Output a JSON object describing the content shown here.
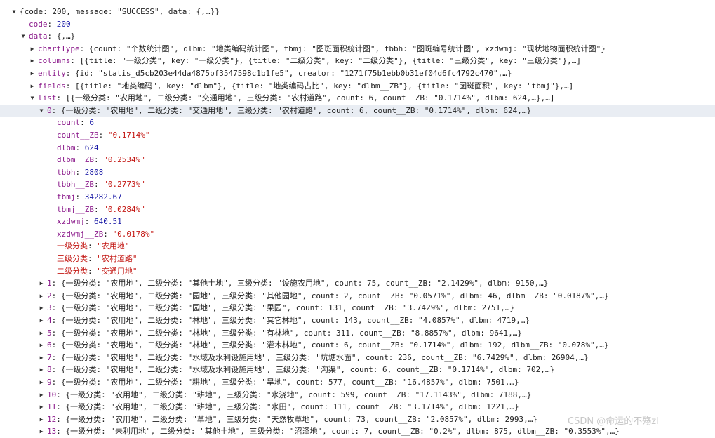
{
  "watermark": "CSDN @命运的不殇zl",
  "lines": [
    {
      "indent": 0,
      "toggle": "open",
      "selected": false,
      "parts": [
        {
          "t": "{code: 200, message: \"SUCCESS\", data: {,…}}",
          "c": "punc"
        }
      ]
    },
    {
      "indent": 1,
      "toggle": "none",
      "selected": false,
      "parts": [
        {
          "t": "code",
          "c": "key"
        },
        {
          "t": ": ",
          "c": "punc"
        },
        {
          "t": "200",
          "c": "num"
        }
      ]
    },
    {
      "indent": 1,
      "toggle": "open",
      "selected": false,
      "parts": [
        {
          "t": "data",
          "c": "key"
        },
        {
          "t": ": {,…}",
          "c": "punc"
        }
      ]
    },
    {
      "indent": 2,
      "toggle": "closed",
      "selected": false,
      "parts": [
        {
          "t": "chartType",
          "c": "key"
        },
        {
          "t": ": {count: \"个数统计图\", dlbm: \"地类编码统计图\", tbmj: \"图斑面积统计图\", tbbh: \"图斑编号统计图\", xzdwmj: \"现状地物面积统计图\"}",
          "c": "punc"
        }
      ]
    },
    {
      "indent": 2,
      "toggle": "closed",
      "selected": false,
      "parts": [
        {
          "t": "columns",
          "c": "key"
        },
        {
          "t": ": [{title: \"一级分类\", key: \"一级分类\"}, {title: \"二级分类\", key: \"二级分类\"}, {title: \"三级分类\", key: \"三级分类\"},…]",
          "c": "punc"
        }
      ]
    },
    {
      "indent": 2,
      "toggle": "closed",
      "selected": false,
      "parts": [
        {
          "t": "entity",
          "c": "key"
        },
        {
          "t": ": {id: \"statis_d5cb203e44da4875bf3547598c1b1fe5\", creator: \"1271f75b1ebb0b31ef04d6fc4792c470\",…}",
          "c": "punc"
        }
      ]
    },
    {
      "indent": 2,
      "toggle": "closed",
      "selected": false,
      "parts": [
        {
          "t": "fields",
          "c": "key"
        },
        {
          "t": ": [{title: \"地类编码\", key: \"dlbm\"}, {title: \"地类编码占比\", key: \"dlbm__ZB\"}, {title: \"图斑面积\", key: \"tbmj\"},…]",
          "c": "punc"
        }
      ]
    },
    {
      "indent": 2,
      "toggle": "open",
      "selected": false,
      "parts": [
        {
          "t": "list",
          "c": "key"
        },
        {
          "t": ": [{一级分类: \"农用地\", 二级分类: \"交通用地\", 三级分类: \"农村道路\", count: 6, count__ZB: \"0.1714%\", dlbm: 624,…},…]",
          "c": "punc"
        }
      ]
    },
    {
      "indent": 3,
      "toggle": "open",
      "selected": true,
      "parts": [
        {
          "t": "0",
          "c": "key"
        },
        {
          "t": ": {一级分类: \"农用地\", 二级分类: \"交通用地\", 三级分类: \"农村道路\", count: 6, count__ZB: \"0.1714%\", dlbm: 624,…}",
          "c": "punc"
        }
      ]
    },
    {
      "indent": 4,
      "toggle": "none",
      "selected": false,
      "parts": [
        {
          "t": "count",
          "c": "key"
        },
        {
          "t": ": ",
          "c": "punc"
        },
        {
          "t": "6",
          "c": "num"
        }
      ]
    },
    {
      "indent": 4,
      "toggle": "none",
      "selected": false,
      "parts": [
        {
          "t": "count__ZB",
          "c": "key"
        },
        {
          "t": ": ",
          "c": "punc"
        },
        {
          "t": "\"0.1714%\"",
          "c": "str"
        }
      ]
    },
    {
      "indent": 4,
      "toggle": "none",
      "selected": false,
      "parts": [
        {
          "t": "dlbm",
          "c": "key"
        },
        {
          "t": ": ",
          "c": "punc"
        },
        {
          "t": "624",
          "c": "num"
        }
      ]
    },
    {
      "indent": 4,
      "toggle": "none",
      "selected": false,
      "parts": [
        {
          "t": "dlbm__ZB",
          "c": "key"
        },
        {
          "t": ": ",
          "c": "punc"
        },
        {
          "t": "\"0.2534%\"",
          "c": "str"
        }
      ]
    },
    {
      "indent": 4,
      "toggle": "none",
      "selected": false,
      "parts": [
        {
          "t": "tbbh",
          "c": "key"
        },
        {
          "t": ": ",
          "c": "punc"
        },
        {
          "t": "2808",
          "c": "num"
        }
      ]
    },
    {
      "indent": 4,
      "toggle": "none",
      "selected": false,
      "parts": [
        {
          "t": "tbbh__ZB",
          "c": "key"
        },
        {
          "t": ": ",
          "c": "punc"
        },
        {
          "t": "\"0.2773%\"",
          "c": "str"
        }
      ]
    },
    {
      "indent": 4,
      "toggle": "none",
      "selected": false,
      "parts": [
        {
          "t": "tbmj",
          "c": "key"
        },
        {
          "t": ": ",
          "c": "punc"
        },
        {
          "t": "34282.67",
          "c": "num"
        }
      ]
    },
    {
      "indent": 4,
      "toggle": "none",
      "selected": false,
      "parts": [
        {
          "t": "tbmj__ZB",
          "c": "key"
        },
        {
          "t": ": ",
          "c": "punc"
        },
        {
          "t": "\"0.0284%\"",
          "c": "str"
        }
      ]
    },
    {
      "indent": 4,
      "toggle": "none",
      "selected": false,
      "parts": [
        {
          "t": "xzdwmj",
          "c": "key"
        },
        {
          "t": ": ",
          "c": "punc"
        },
        {
          "t": "640.51",
          "c": "num"
        }
      ]
    },
    {
      "indent": 4,
      "toggle": "none",
      "selected": false,
      "parts": [
        {
          "t": "xzdwmj__ZB",
          "c": "key"
        },
        {
          "t": ": ",
          "c": "punc"
        },
        {
          "t": "\"0.0178%\"",
          "c": "str"
        }
      ]
    },
    {
      "indent": 4,
      "toggle": "none",
      "selected": false,
      "parts": [
        {
          "t": "一级分类",
          "c": "key plain"
        },
        {
          "t": ": ",
          "c": "punc"
        },
        {
          "t": "\"农用地\"",
          "c": "str"
        }
      ]
    },
    {
      "indent": 4,
      "toggle": "none",
      "selected": false,
      "parts": [
        {
          "t": "三级分类",
          "c": "key plain"
        },
        {
          "t": ": ",
          "c": "punc"
        },
        {
          "t": "\"农村道路\"",
          "c": "str"
        }
      ]
    },
    {
      "indent": 4,
      "toggle": "none",
      "selected": false,
      "parts": [
        {
          "t": "二级分类",
          "c": "key plain"
        },
        {
          "t": ": ",
          "c": "punc"
        },
        {
          "t": "\"交通用地\"",
          "c": "str"
        }
      ]
    },
    {
      "indent": 3,
      "toggle": "closed",
      "selected": false,
      "parts": [
        {
          "t": "1",
          "c": "key"
        },
        {
          "t": ": {一级分类: \"农用地\", 二级分类: \"其他土地\", 三级分类: \"设施农用地\", count: 75, count__ZB: \"2.1429%\", dlbm: 9150,…}",
          "c": "punc"
        }
      ]
    },
    {
      "indent": 3,
      "toggle": "closed",
      "selected": false,
      "parts": [
        {
          "t": "2",
          "c": "key"
        },
        {
          "t": ": {一级分类: \"农用地\", 二级分类: \"园地\", 三级分类: \"其他园地\", count: 2, count__ZB: \"0.0571%\", dlbm: 46, dlbm__ZB: \"0.0187%\",…}",
          "c": "punc"
        }
      ]
    },
    {
      "indent": 3,
      "toggle": "closed",
      "selected": false,
      "parts": [
        {
          "t": "3",
          "c": "key"
        },
        {
          "t": ": {一级分类: \"农用地\", 二级分类: \"园地\", 三级分类: \"果园\", count: 131, count__ZB: \"3.7429%\", dlbm: 2751,…}",
          "c": "punc"
        }
      ]
    },
    {
      "indent": 3,
      "toggle": "closed",
      "selected": false,
      "parts": [
        {
          "t": "4",
          "c": "key"
        },
        {
          "t": ": {一级分类: \"农用地\", 二级分类: \"林地\", 三级分类: \"其它林地\", count: 143, count__ZB: \"4.0857%\", dlbm: 4719,…}",
          "c": "punc"
        }
      ]
    },
    {
      "indent": 3,
      "toggle": "closed",
      "selected": false,
      "parts": [
        {
          "t": "5",
          "c": "key"
        },
        {
          "t": ": {一级分类: \"农用地\", 二级分类: \"林地\", 三级分类: \"有林地\", count: 311, count__ZB: \"8.8857%\", dlbm: 9641,…}",
          "c": "punc"
        }
      ]
    },
    {
      "indent": 3,
      "toggle": "closed",
      "selected": false,
      "parts": [
        {
          "t": "6",
          "c": "key"
        },
        {
          "t": ": {一级分类: \"农用地\", 二级分类: \"林地\", 三级分类: \"灌木林地\", count: 6, count__ZB: \"0.1714%\", dlbm: 192, dlbm__ZB: \"0.078%\",…}",
          "c": "punc"
        }
      ]
    },
    {
      "indent": 3,
      "toggle": "closed",
      "selected": false,
      "parts": [
        {
          "t": "7",
          "c": "key"
        },
        {
          "t": ": {一级分类: \"农用地\", 二级分类: \"水域及水利设施用地\", 三级分类: \"坑塘水面\", count: 236, count__ZB: \"6.7429%\", dlbm: 26904,…}",
          "c": "punc"
        }
      ]
    },
    {
      "indent": 3,
      "toggle": "closed",
      "selected": false,
      "parts": [
        {
          "t": "8",
          "c": "key"
        },
        {
          "t": ": {一级分类: \"农用地\", 二级分类: \"水域及水利设施用地\", 三级分类: \"沟渠\", count: 6, count__ZB: \"0.1714%\", dlbm: 702,…}",
          "c": "punc"
        }
      ]
    },
    {
      "indent": 3,
      "toggle": "closed",
      "selected": false,
      "parts": [
        {
          "t": "9",
          "c": "key"
        },
        {
          "t": ": {一级分类: \"农用地\", 二级分类: \"耕地\", 三级分类: \"旱地\", count: 577, count__ZB: \"16.4857%\", dlbm: 7501,…}",
          "c": "punc"
        }
      ]
    },
    {
      "indent": 3,
      "toggle": "closed",
      "selected": false,
      "parts": [
        {
          "t": "10",
          "c": "key"
        },
        {
          "t": ": {一级分类: \"农用地\", 二级分类: \"耕地\", 三级分类: \"水浇地\", count: 599, count__ZB: \"17.1143%\", dlbm: 7188,…}",
          "c": "punc"
        }
      ]
    },
    {
      "indent": 3,
      "toggle": "closed",
      "selected": false,
      "parts": [
        {
          "t": "11",
          "c": "key"
        },
        {
          "t": ": {一级分类: \"农用地\", 二级分类: \"耕地\", 三级分类: \"水田\", count: 111, count__ZB: \"3.1714%\", dlbm: 1221,…}",
          "c": "punc"
        }
      ]
    },
    {
      "indent": 3,
      "toggle": "closed",
      "selected": false,
      "parts": [
        {
          "t": "12",
          "c": "key"
        },
        {
          "t": ": {一级分类: \"农用地\", 二级分类: \"草地\", 三级分类: \"天然牧草地\", count: 73, count__ZB: \"2.0857%\", dlbm: 2993,…}",
          "c": "punc"
        }
      ]
    },
    {
      "indent": 3,
      "toggle": "closed",
      "selected": false,
      "parts": [
        {
          "t": "13",
          "c": "key"
        },
        {
          "t": ": {一级分类: \"未利用地\", 二级分类: \"其他土地\", 三级分类: \"沼泽地\", count: 7, count__ZB: \"0.2%\", dlbm: 875, dlbm__ZB: \"0.3553%\",…}",
          "c": "punc"
        }
      ]
    }
  ]
}
